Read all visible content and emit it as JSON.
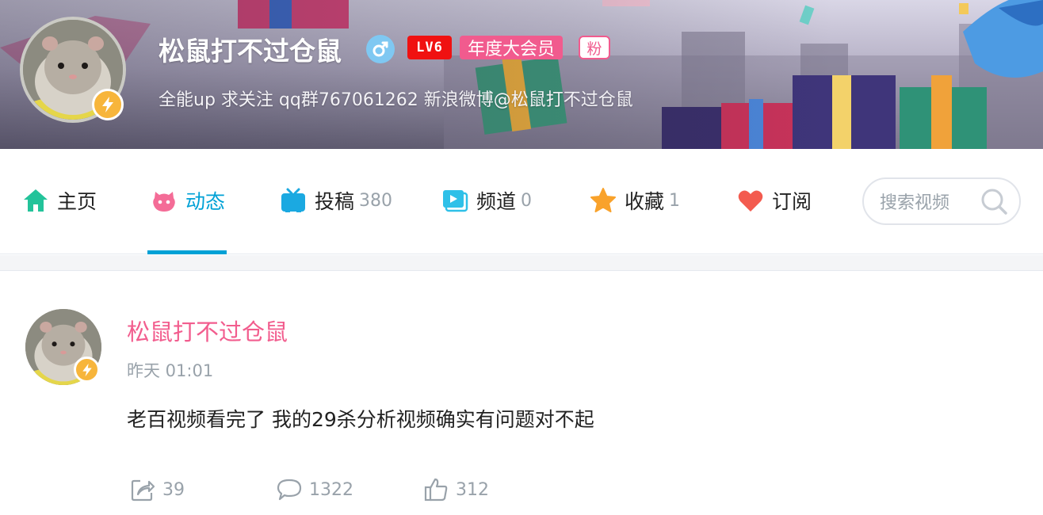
{
  "header": {
    "username": "松鼠打不过仓鼠",
    "gender_icon": "male-icon",
    "level": "LV6",
    "vip_label": "年度大会员",
    "fan_badge": "粉",
    "sign": "全能up 求关注 qq群767061262 新浪微博@松鼠打不过仓鼠"
  },
  "nav": {
    "items": [
      {
        "label": "主页",
        "icon": "home-icon",
        "count": ""
      },
      {
        "label": "动态",
        "icon": "dynamic-icon",
        "count": ""
      },
      {
        "label": "投稿",
        "icon": "tv-icon",
        "count": "380"
      },
      {
        "label": "频道",
        "icon": "channel-icon",
        "count": "0"
      },
      {
        "label": "收藏",
        "icon": "star-icon",
        "count": "1"
      },
      {
        "label": "订阅",
        "icon": "heart-icon",
        "count": ""
      }
    ],
    "active_index": 1,
    "search_placeholder": "搜索视频"
  },
  "post": {
    "username": "松鼠打不过仓鼠",
    "time": "昨天 01:01",
    "text": "老百视频看完了 我的29杀分析视频确实有问题对不起",
    "forward_count": "39",
    "comment_count": "1322",
    "like_count": "312"
  },
  "colors": {
    "accent": "#00a1d6",
    "pink": "#f25d8e",
    "level_red": "#f01111",
    "bolt": "#f7b53b"
  }
}
